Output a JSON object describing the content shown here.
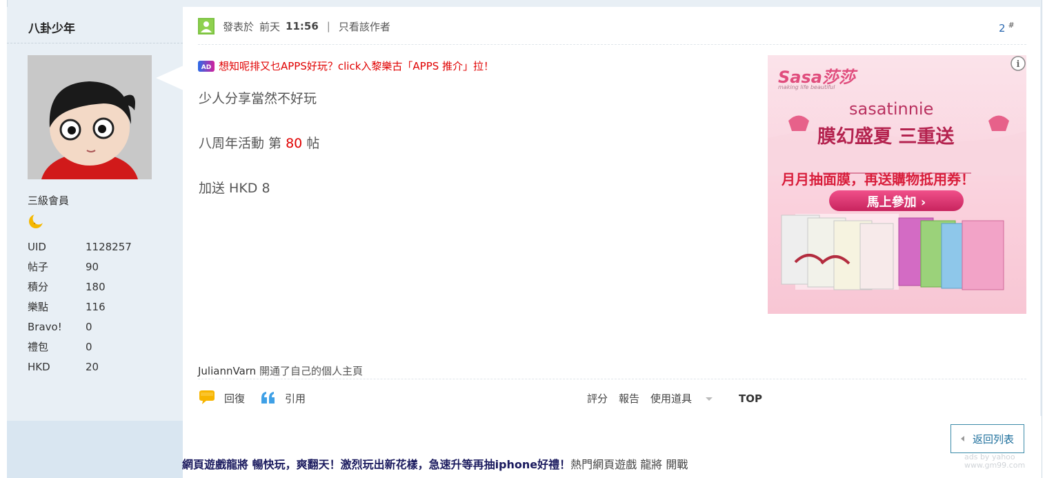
{
  "author": {
    "name": "八卦少年",
    "rank": "三級會員",
    "rank_icon": "crescent-moon-icon",
    "stats": [
      {
        "key": "UID",
        "value": "1128257"
      },
      {
        "key": "帖子",
        "value": "90"
      },
      {
        "key": "積分",
        "value": "180"
      },
      {
        "key": "樂點",
        "value": "116"
      },
      {
        "key": "Bravo!",
        "value": "0"
      },
      {
        "key": "禮包",
        "value": "0"
      },
      {
        "key": "HKD",
        "value": "20"
      }
    ]
  },
  "post": {
    "posted_label": "發表於",
    "posted_day": "前天",
    "posted_time": "11:56",
    "separator": "|",
    "author_only": "只看該作者",
    "floor_number": "2",
    "floor_mark": "#",
    "ad_link": "想知呢排又乜APPS好玩？click入黎樂古「APPS 推介」拉！",
    "body": {
      "line1": "少人分享當然不好玩",
      "line2_prefix": "八周年活動 第",
      "line2_number": "80",
      "line2_suffix": "帖",
      "line3": "加送 HKD 8"
    },
    "activity_user": "JuliannVarn",
    "activity_text": "開通了自己的個人主頁"
  },
  "banner": {
    "brand": "Sasa莎莎",
    "tagline": "making life beautiful",
    "sub_brand": "sasatinnie",
    "headline": "膜幻盛夏 三重送",
    "offer": "月月抽面膜，再送購物抵用券！",
    "cta": "馬上參加 ›",
    "info_icon": "info-icon"
  },
  "actions": {
    "reply": "回復",
    "quote": "引用",
    "rate": "評分",
    "report": "報告",
    "tools": "使用道具",
    "top": "TOP"
  },
  "back_button": "返回列表",
  "bottom_ad": {
    "headline": "網頁遊戲龍將 暢快玩，爽翻天！激烈玩出新花樣，急速升等再抽iphone好禮！",
    "tail": "熱門網頁遊戲 龍將 開戰"
  },
  "ads_by": {
    "line1": "ads by yahoo",
    "line2": "www.gm99.com"
  },
  "colors": {
    "accent_red": "#e00000",
    "link_blue": "#2a68b0",
    "sidebar_bg": "#e8eff5",
    "banner_pink": "#e84a7f"
  }
}
